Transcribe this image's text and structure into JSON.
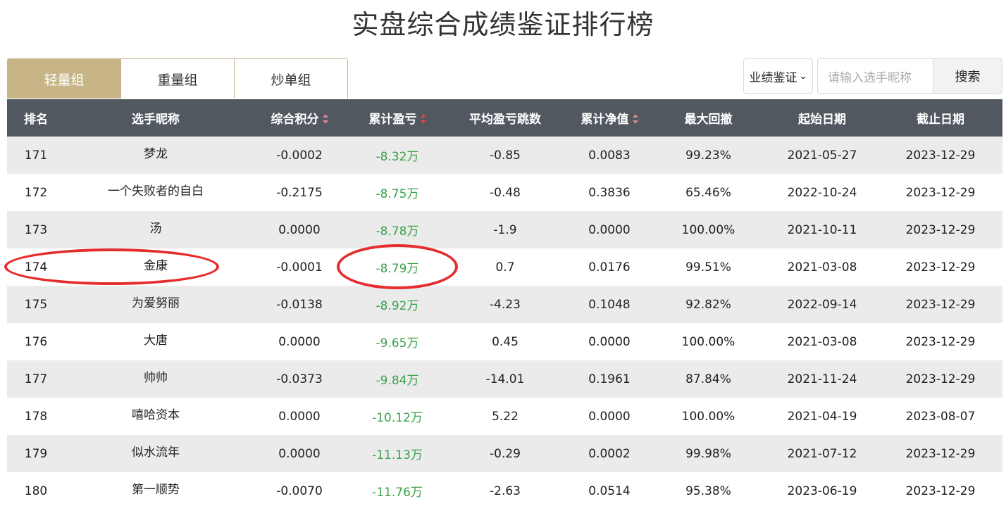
{
  "page": {
    "title": "实盘综合成绩鉴证排行榜"
  },
  "tabs": [
    {
      "label": "轻量组",
      "active": true
    },
    {
      "label": "重量组",
      "active": false
    },
    {
      "label": "炒单组",
      "active": false
    }
  ],
  "search": {
    "select_value": "业绩鉴证",
    "placeholder": "请输入选手昵称",
    "button_label": "搜索"
  },
  "table": {
    "headers": [
      "排名",
      "选手昵称",
      "综合积分",
      "累计盈亏",
      "平均盈亏跳数",
      "累计净值",
      "最大回撤",
      "起始日期",
      "截止日期"
    ],
    "sortable_columns": [
      2,
      3,
      5
    ],
    "active_sort_column": 3,
    "rows": [
      [
        "171",
        "梦龙",
        "-0.0002",
        "-8.32万",
        "-0.85",
        "0.0083",
        "99.23%",
        "2021-05-27",
        "2023-12-29"
      ],
      [
        "172",
        "一个失败者的自白",
        "-0.2175",
        "-8.75万",
        "-0.48",
        "0.3836",
        "65.46%",
        "2022-10-24",
        "2023-12-29"
      ],
      [
        "173",
        "汤",
        "0.0000",
        "-8.78万",
        "-1.9",
        "0.0000",
        "100.00%",
        "2021-10-11",
        "2023-12-29"
      ],
      [
        "174",
        "金康",
        "-0.0001",
        "-8.79万",
        "0.7",
        "0.0176",
        "99.51%",
        "2021-03-08",
        "2023-12-29"
      ],
      [
        "175",
        "为爱努丽",
        "-0.0138",
        "-8.92万",
        "-4.23",
        "0.1048",
        "92.82%",
        "2022-09-14",
        "2023-12-29"
      ],
      [
        "176",
        "大唐",
        "0.0000",
        "-9.65万",
        "0.45",
        "0.0000",
        "100.00%",
        "2021-03-08",
        "2023-12-29"
      ],
      [
        "177",
        "帅帅",
        "-0.0373",
        "-9.84万",
        "-14.01",
        "0.1961",
        "87.84%",
        "2021-11-24",
        "2023-12-29"
      ],
      [
        "178",
        "嘻哈资本",
        "0.0000",
        "-10.12万",
        "5.22",
        "0.0000",
        "100.00%",
        "2021-04-19",
        "2023-08-07"
      ],
      [
        "179",
        "似水流年",
        "0.0000",
        "-11.13万",
        "-0.29",
        "0.0002",
        "99.98%",
        "2021-07-12",
        "2023-12-29"
      ],
      [
        "180",
        "第一顺势",
        "-0.0070",
        "-11.76万",
        "-2.63",
        "0.0514",
        "95.38%",
        "2023-06-19",
        "2023-12-29"
      ]
    ]
  },
  "colors": {
    "accent_gold": "#c8b587",
    "header_bg": "#515860",
    "loss_green": "#3aa24a",
    "annotation_red": "#e52d2d"
  }
}
